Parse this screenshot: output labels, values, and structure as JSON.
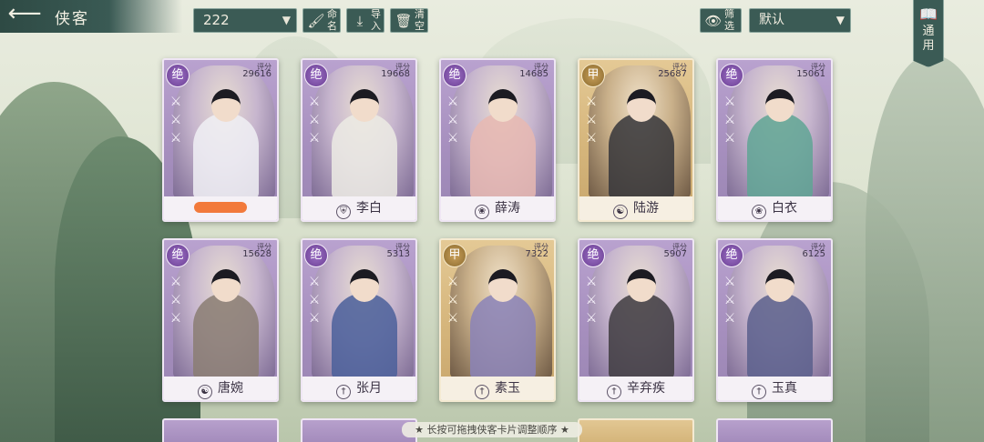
{
  "header": {
    "title": "侠客",
    "team_select": "222",
    "buttons": {
      "rename": "命名",
      "import": "导入",
      "clear": "清空",
      "filter": "筛选"
    },
    "sort_select": "默认",
    "general_tab": "通用"
  },
  "score_label": "评分",
  "cards": [
    {
      "rank": "绝",
      "score": "29616",
      "name": "",
      "style": "purple"
    },
    {
      "rank": "绝",
      "score": "19668",
      "name": "李白",
      "style": "purple"
    },
    {
      "rank": "绝",
      "score": "14685",
      "name": "薛涛",
      "style": "purple"
    },
    {
      "rank": "甲",
      "score": "25687",
      "name": "陆游",
      "style": "gold"
    },
    {
      "rank": "绝",
      "score": "15061",
      "name": "白衣",
      "style": "purple"
    },
    {
      "rank": "绝",
      "score": "15628",
      "name": "唐婉",
      "style": "purple"
    },
    {
      "rank": "绝",
      "score": "5313",
      "name": "张月",
      "style": "purple"
    },
    {
      "rank": "甲",
      "score": "7322",
      "name": "素玉",
      "style": "gold"
    },
    {
      "rank": "绝",
      "score": "5907",
      "name": "辛弃疾",
      "style": "purple"
    },
    {
      "rank": "绝",
      "score": "6125",
      "name": "玉真",
      "style": "purple"
    }
  ],
  "hint": "★ 长按可拖拽侠客卡片调整顺序 ★"
}
